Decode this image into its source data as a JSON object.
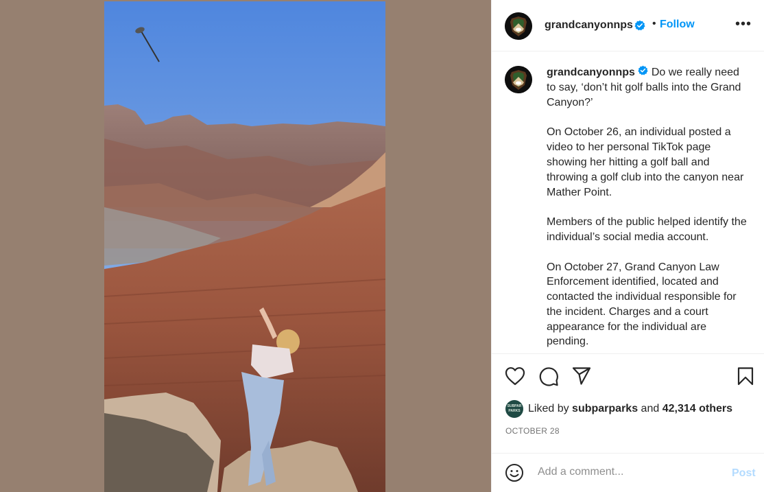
{
  "post": {
    "media": {
      "description_icon": "grand-canyon-golf-video"
    },
    "header": {
      "username": "grandcanyonnps",
      "verified_icon": "verified-badge-icon",
      "separator": "•",
      "follow_label": "Follow",
      "more_icon": "more-options-icon",
      "more_label": "•••"
    },
    "caption": {
      "username": "grandcanyonnps",
      "paragraphs": [
        "Do we really need to say, ‘don’t hit golf balls into the Grand Canyon?’",
        "On October 26, an individual posted a video to her personal TikTok page showing her hitting a golf ball and throwing a golf club into the canyon near Mather Point.",
        "Members of the public helped identify the individual’s social media account.",
        "On October 27, Grand Canyon Law Enforcement identified, located and contacted the individual responsible for the incident. Charges and a court appearance for the individual are pending."
      ]
    },
    "actions": {
      "icons": [
        "heart-icon",
        "comment-icon",
        "share-icon",
        "bookmark-icon"
      ]
    },
    "likes": {
      "avatar_text": "SUBPAR PARKS",
      "prefix": "Liked by",
      "liker": "subparparks",
      "conjunction": "and",
      "others": "42,314 others"
    },
    "date": "OCTOBER 28",
    "comment": {
      "placeholder": "Add a comment...",
      "post_label": "Post"
    },
    "colors": {
      "link_blue": "#0095f6",
      "post_disabled": "#b3dbff",
      "media_background": "#968070"
    }
  }
}
